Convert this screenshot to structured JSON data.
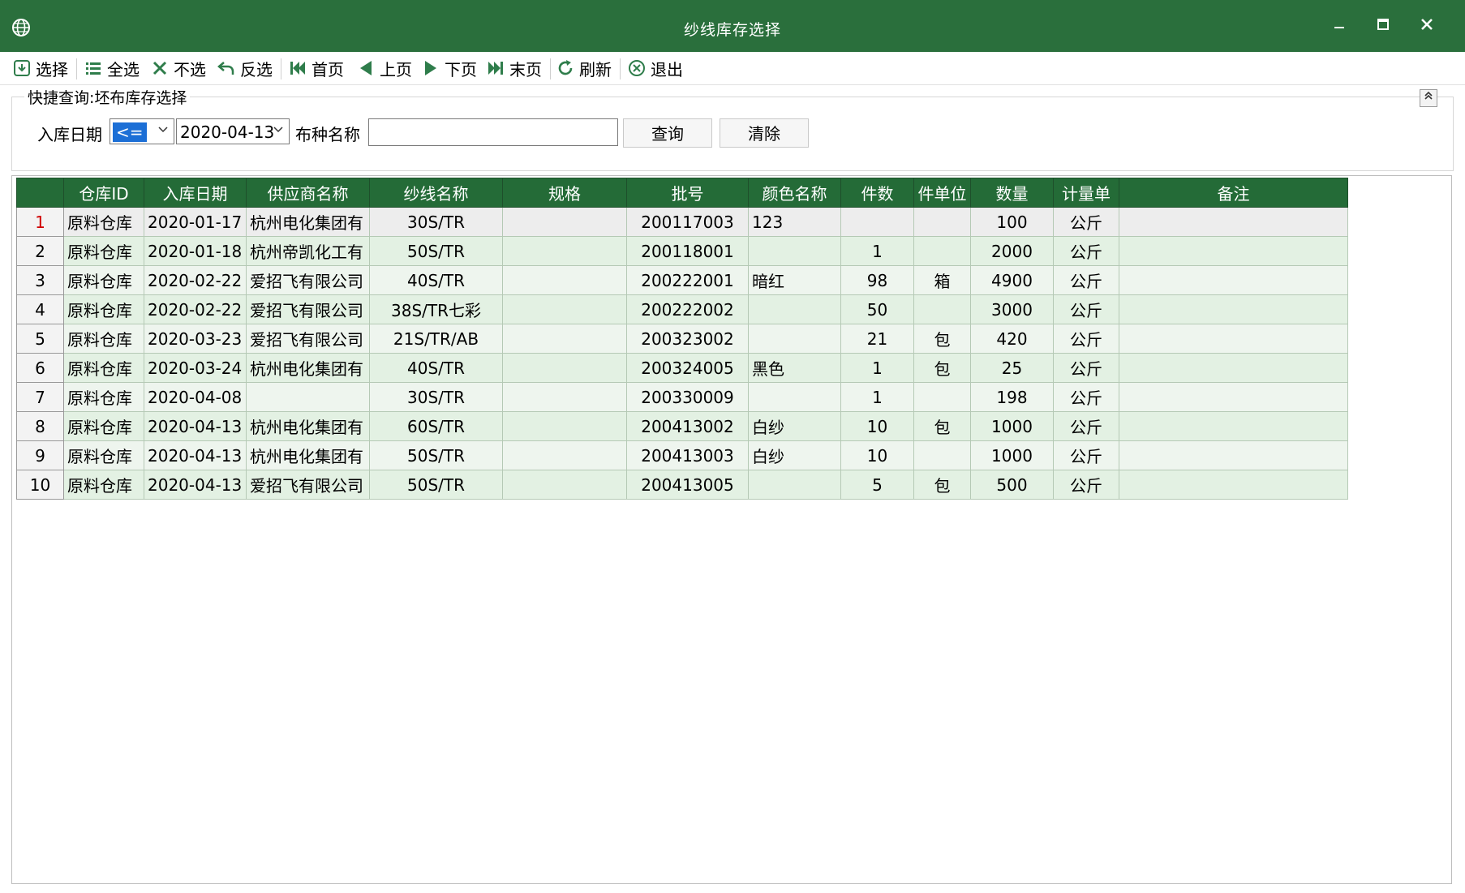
{
  "window": {
    "title": "纱线库存选择"
  },
  "toolbar": {
    "select": "选择",
    "select_all": "全选",
    "deselect": "不选",
    "invert": "反选",
    "first": "首页",
    "prev": "上页",
    "next": "下页",
    "last": "末页",
    "refresh": "刷新",
    "exit": "退出"
  },
  "query": {
    "legend": "快捷查询:坯布库存选择",
    "date_label": "入库日期",
    "operator": "<=",
    "date_value": "2020-04-13",
    "fabric_label": "布种名称",
    "fabric_value": "",
    "search_btn": "查询",
    "clear_btn": "清除"
  },
  "grid": {
    "columns": [
      "仓库ID",
      "入库日期",
      "供应商名称",
      "纱线名称",
      "规格",
      "批号",
      "颜色名称",
      "件数",
      "件单位",
      "数量",
      "计量单",
      "备注"
    ],
    "rows": [
      {
        "n": "1",
        "wh": "原料仓库",
        "date": "2020-01-17",
        "supplier": "杭州电化集团有",
        "yarn": "30S/TR",
        "spec": "",
        "batch": "200117003",
        "color": "123",
        "pieces": "",
        "unit": "",
        "qty": "100",
        "uom": "公斤",
        "note": ""
      },
      {
        "n": "2",
        "wh": "原料仓库",
        "date": "2020-01-18",
        "supplier": "杭州帝凯化工有",
        "yarn": "50S/TR",
        "spec": "",
        "batch": "200118001",
        "color": "",
        "pieces": "1",
        "unit": "",
        "qty": "2000",
        "uom": "公斤",
        "note": ""
      },
      {
        "n": "3",
        "wh": "原料仓库",
        "date": "2020-02-22",
        "supplier": "爱招飞有限公司",
        "yarn": "40S/TR",
        "spec": "",
        "batch": "200222001",
        "color": "暗红",
        "pieces": "98",
        "unit": "箱",
        "qty": "4900",
        "uom": "公斤",
        "note": ""
      },
      {
        "n": "4",
        "wh": "原料仓库",
        "date": "2020-02-22",
        "supplier": "爱招飞有限公司",
        "yarn": "38S/TR七彩",
        "spec": "",
        "batch": "200222002",
        "color": "",
        "pieces": "50",
        "unit": "",
        "qty": "3000",
        "uom": "公斤",
        "note": ""
      },
      {
        "n": "5",
        "wh": "原料仓库",
        "date": "2020-03-23",
        "supplier": "爱招飞有限公司",
        "yarn": "21S/TR/AB",
        "spec": "",
        "batch": "200323002",
        "color": "",
        "pieces": "21",
        "unit": "包",
        "qty": "420",
        "uom": "公斤",
        "note": ""
      },
      {
        "n": "6",
        "wh": "原料仓库",
        "date": "2020-03-24",
        "supplier": "杭州电化集团有",
        "yarn": "40S/TR",
        "spec": "",
        "batch": "200324005",
        "color": "黑色",
        "pieces": "1",
        "unit": "包",
        "qty": "25",
        "uom": "公斤",
        "note": ""
      },
      {
        "n": "7",
        "wh": "原料仓库",
        "date": "2020-04-08",
        "supplier": "",
        "yarn": "30S/TR",
        "spec": "",
        "batch": "200330009",
        "color": "",
        "pieces": "1",
        "unit": "",
        "qty": "198",
        "uom": "公斤",
        "note": ""
      },
      {
        "n": "8",
        "wh": "原料仓库",
        "date": "2020-04-13",
        "supplier": "杭州电化集团有",
        "yarn": "60S/TR",
        "spec": "",
        "batch": "200413002",
        "color": "白纱",
        "pieces": "10",
        "unit": "包",
        "qty": "1000",
        "uom": "公斤",
        "note": ""
      },
      {
        "n": "9",
        "wh": "原料仓库",
        "date": "2020-04-13",
        "supplier": "杭州电化集团有",
        "yarn": "50S/TR",
        "spec": "",
        "batch": "200413003",
        "color": "白纱",
        "pieces": "10",
        "unit": "",
        "qty": "1000",
        "uom": "公斤",
        "note": ""
      },
      {
        "n": "10",
        "wh": "原料仓库",
        "date": "2020-04-13",
        "supplier": "爱招飞有限公司",
        "yarn": "50S/TR",
        "spec": "",
        "batch": "200413005",
        "color": "",
        "pieces": "5",
        "unit": "包",
        "qty": "500",
        "uom": "公斤",
        "note": ""
      }
    ]
  },
  "colors": {
    "titlebar": "#2a6f3c",
    "header": "#246b37",
    "row_a": "#eef5ee",
    "row_b": "#e3f1e3",
    "selected_rownum": "#d00000"
  },
  "icons": [
    "globe-icon",
    "minimize-icon",
    "maximize-icon",
    "close-icon",
    "select-icon",
    "list-icon",
    "x-icon",
    "undo-icon",
    "first-page-icon",
    "prev-icon",
    "next-icon",
    "last-page-icon",
    "refresh-icon",
    "exit-icon",
    "chevron-up-icon",
    "chevron-down-icon"
  ]
}
